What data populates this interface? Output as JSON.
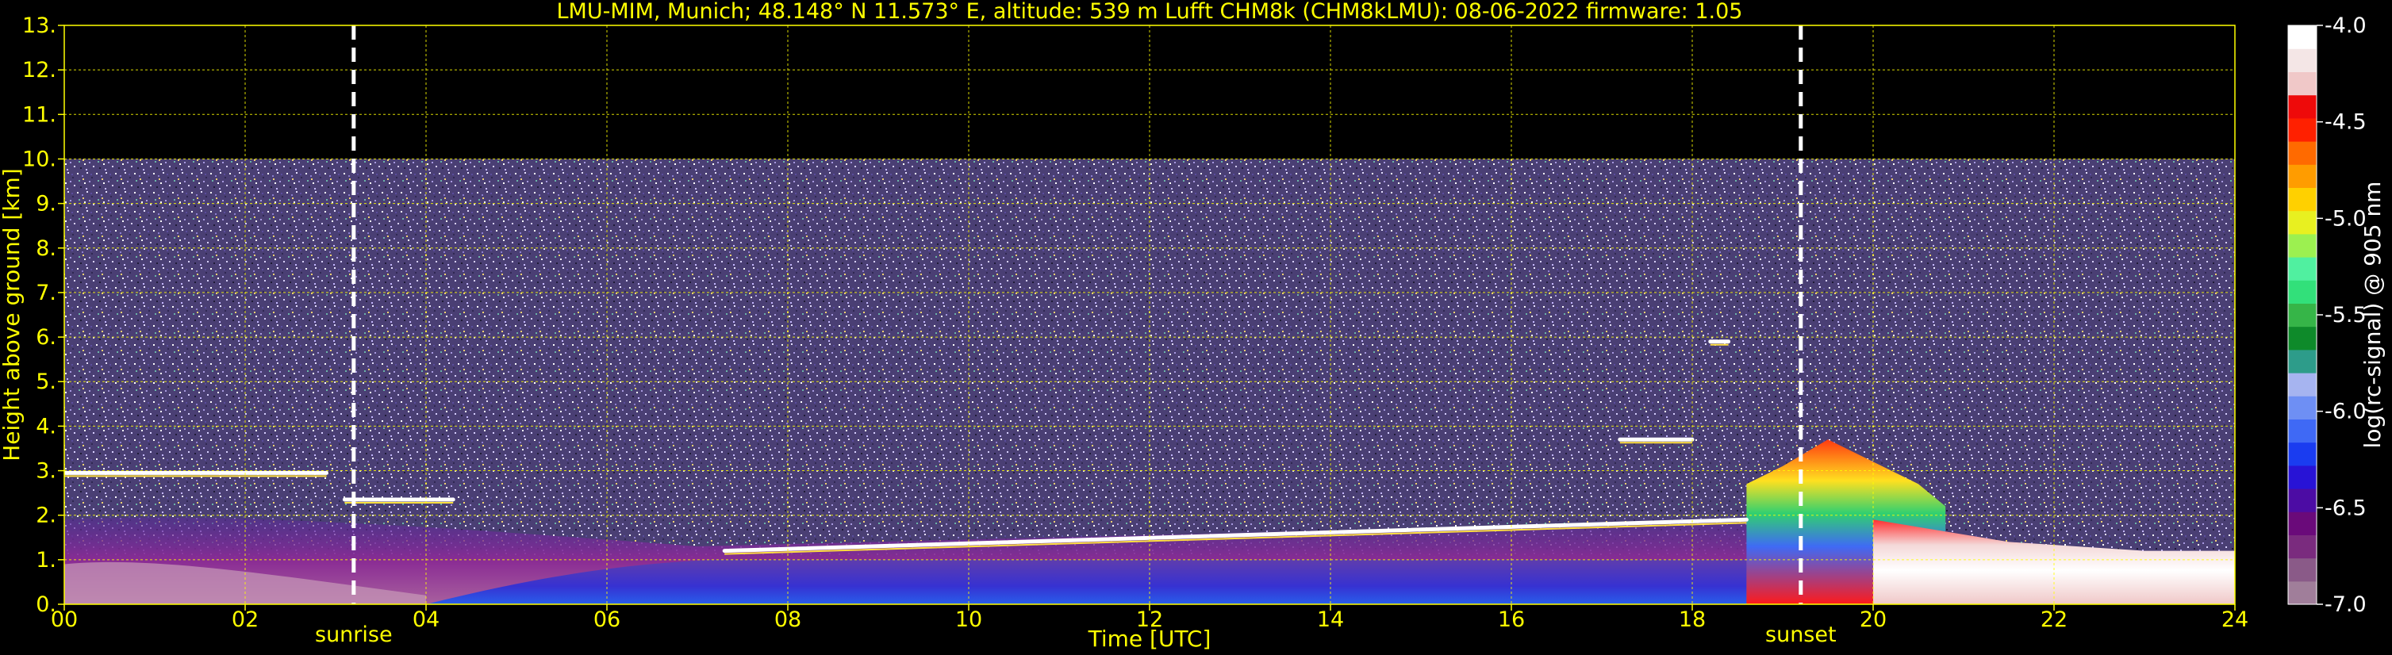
{
  "chart_data": {
    "type": "heatmap",
    "title": "LMU-MIM, Munich; 48.148° N 11.573° E, altitude: 539 m    Lufft CHM8k (CHM8kLMU): 08-06-2022    firmware: 1.05",
    "xlabel": "Time [UTC]",
    "ylabel": "Height above ground [km]",
    "xlim": [
      0,
      24
    ],
    "ylim": [
      0,
      13
    ],
    "x_ticks": [
      "00",
      "02",
      "04",
      "06",
      "08",
      "10",
      "12",
      "14",
      "16",
      "18",
      "20",
      "22",
      "24"
    ],
    "y_ticks": [
      "0.",
      "1.",
      "2.",
      "3.",
      "4.",
      "5.",
      "6.",
      "7.",
      "8.",
      "9.",
      "10.",
      "11.",
      "12.",
      "13."
    ],
    "grid": true,
    "data_top_km": 10,
    "events": [
      {
        "label": "sunrise",
        "time": 3.2
      },
      {
        "label": "sunset",
        "time": 19.2
      }
    ],
    "colorbar": {
      "label": "log(rc-signal) @ 905 nm",
      "ticks": [
        "-4.0",
        "-4.5",
        "-5.0",
        "-5.5",
        "-6.0",
        "-6.5",
        "-7.0"
      ],
      "range": [
        -7.0,
        -4.0
      ],
      "colors": [
        "#a07e9a",
        "#8a5a88",
        "#7a2b7e",
        "#6a0a7a",
        "#4c0ca4",
        "#2813d6",
        "#1a3cf0",
        "#3f69f5",
        "#6e8ff4",
        "#a6b4f0",
        "#2d9c8a",
        "#0e8a2a",
        "#36b548",
        "#32e07a",
        "#50f0a0",
        "#9cf050",
        "#e8f020",
        "#ffd000",
        "#ff9c00",
        "#ff6a00",
        "#ff2000",
        "#ee0a0a",
        "#f0c8c8",
        "#f4e6e6",
        "#ffffff"
      ]
    },
    "cloud_layers": [
      {
        "t0": 0.0,
        "t1": 2.9,
        "h": 2.95
      },
      {
        "t0": 3.1,
        "t1": 4.3,
        "h": 2.35
      },
      {
        "t0": 7.3,
        "t1": 18.6,
        "h": 1.2,
        "h1": 1.9
      },
      {
        "t0": 17.2,
        "t1": 18.0,
        "h": 3.7
      },
      {
        "t0": 18.2,
        "t1": 18.4,
        "h": 5.9
      }
    ]
  }
}
